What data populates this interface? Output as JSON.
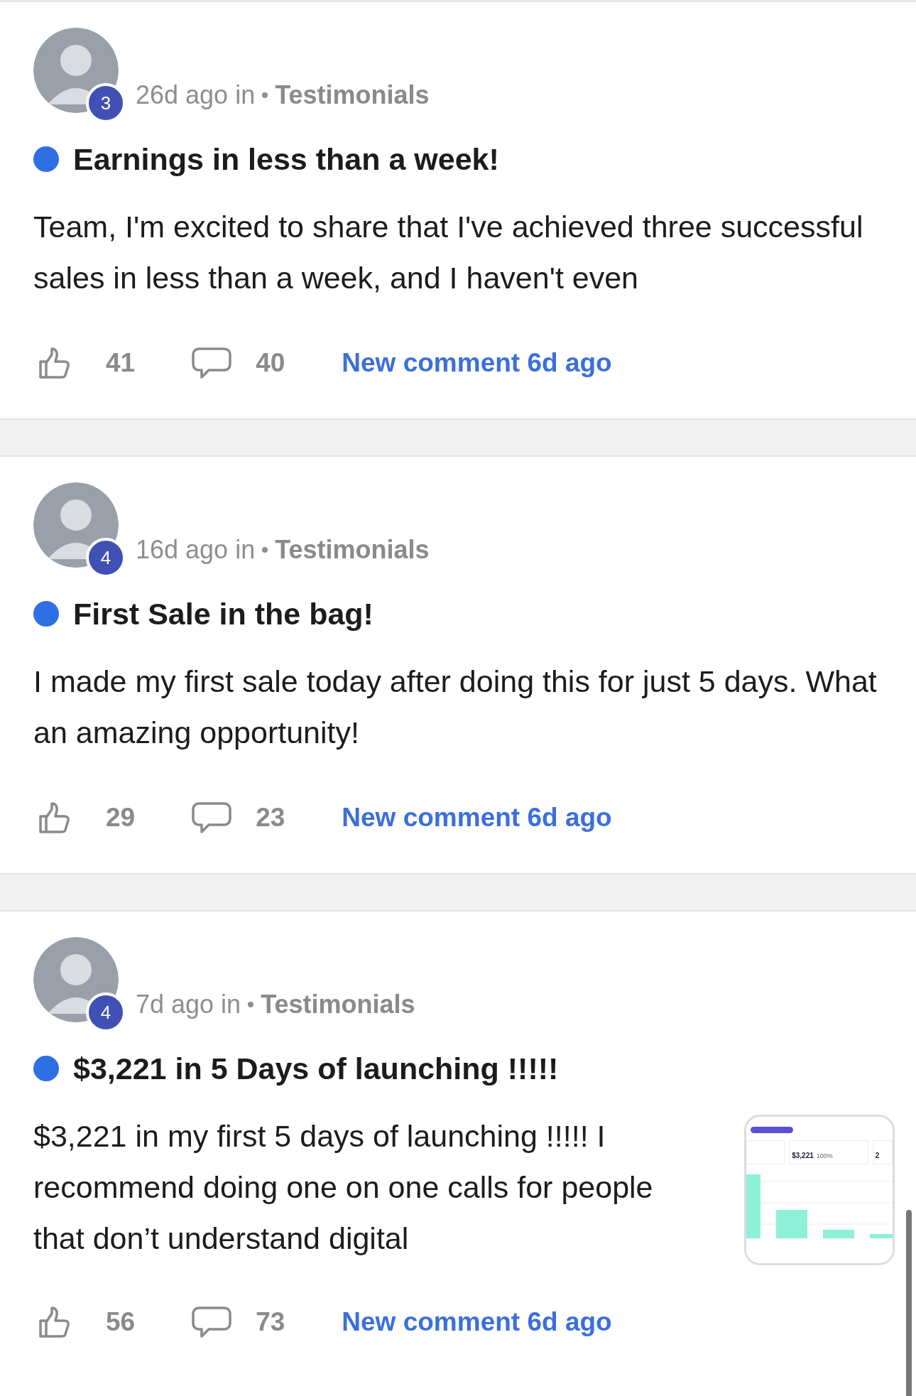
{
  "posts": [
    {
      "avatar_badge": "3",
      "time": "26d ago in",
      "category": "Testimonials",
      "unread": true,
      "title": "Earnings in less than a week!",
      "body": "Team, I'm excited to share that I've achieved three successful sales in less than a week, and I haven't even",
      "likes": "41",
      "comments": "40",
      "last_activity": "New comment 6d ago"
    },
    {
      "avatar_badge": "4",
      "time": "16d ago in",
      "category": "Testimonials",
      "unread": true,
      "title": "First Sale in the bag!",
      "body": "I made my first sale today after doing this for just 5 days. What an amazing opportunity!",
      "likes": "29",
      "comments": "23",
      "last_activity": "New comment 6d ago"
    },
    {
      "avatar_badge": "4",
      "time": "7d ago in",
      "category": "Testimonials",
      "unread": true,
      "title": "$3,221 in 5 Days of launching !!!!!",
      "body": "$3,221 in my first 5 days of launching !!!!! I recommend doing one on one calls for people that don’t understand digital",
      "likes": "56",
      "comments": "73",
      "last_activity": "New comment 6d ago",
      "attachment": {
        "kind": "dashboard",
        "revenue": "$3,221",
        "change": "100%",
        "next_value": "2"
      }
    }
  ]
}
